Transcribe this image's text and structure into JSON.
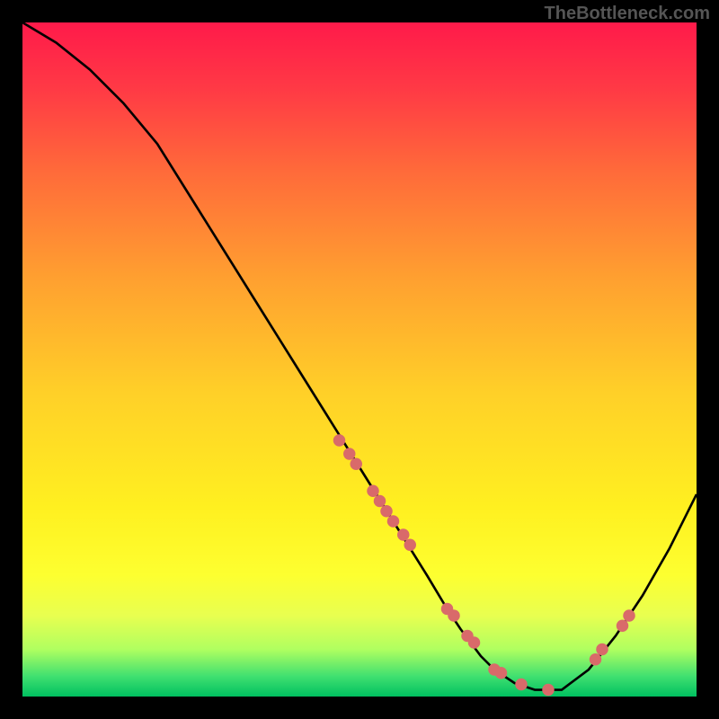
{
  "watermark": "TheBottleneck.com",
  "chart_data": {
    "type": "line",
    "title": "",
    "xlabel": "",
    "ylabel": "",
    "xlim": [
      0,
      100
    ],
    "ylim": [
      0,
      100
    ],
    "curve": {
      "x": [
        0,
        5,
        10,
        15,
        20,
        25,
        30,
        35,
        40,
        45,
        50,
        55,
        60,
        63,
        65,
        68,
        70,
        73,
        76,
        80,
        84,
        88,
        92,
        96,
        100
      ],
      "y": [
        100,
        97,
        93,
        88,
        82,
        74,
        66,
        58,
        50,
        42,
        34,
        26,
        18,
        13,
        10,
        6,
        4,
        2,
        1,
        1,
        4,
        9,
        15,
        22,
        30
      ]
    },
    "markers": {
      "x": [
        47,
        48.5,
        49.5,
        52,
        53,
        54,
        55,
        56.5,
        57.5,
        63,
        64,
        66,
        67,
        70,
        71,
        74,
        78,
        85,
        86,
        89,
        90
      ],
      "y": [
        38,
        36,
        34.5,
        30.5,
        29,
        27.5,
        26,
        24,
        22.5,
        13,
        12,
        9,
        8,
        4,
        3.5,
        1.8,
        1,
        5.5,
        7,
        10.5,
        12
      ]
    },
    "marker_color": "#d96a6a",
    "curve_color": "#000000"
  }
}
